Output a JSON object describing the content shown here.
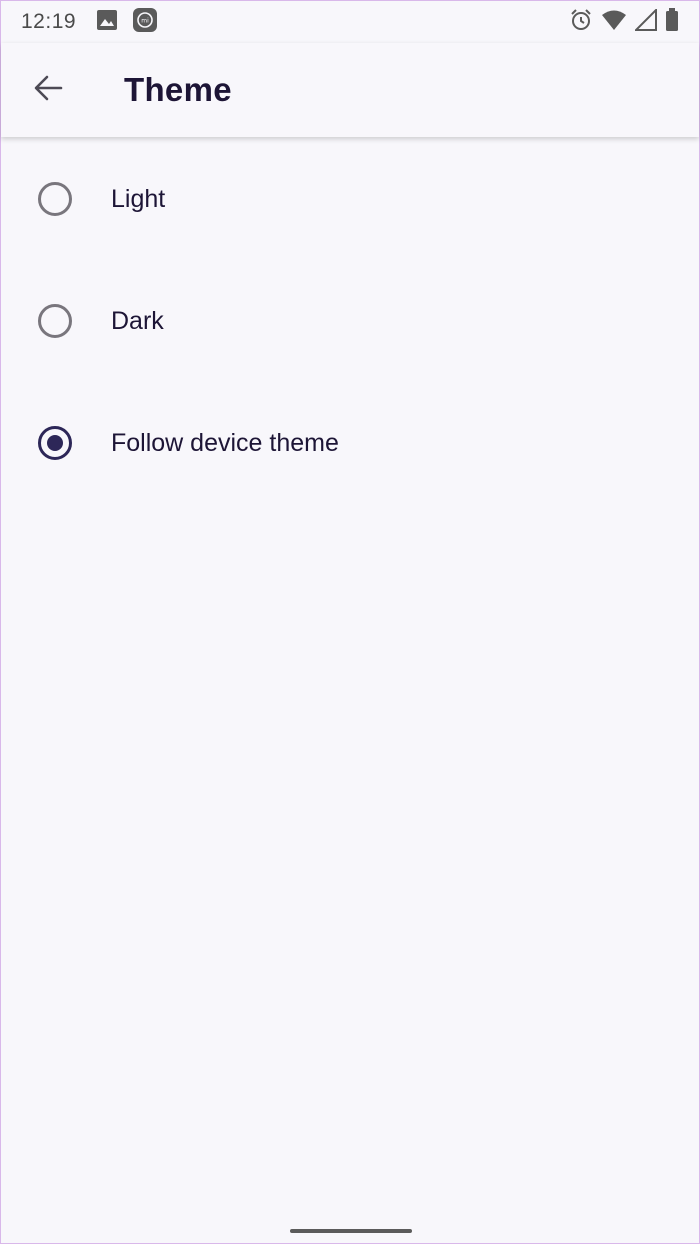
{
  "status_bar": {
    "time": "12:19",
    "left_icons": [
      "image-icon",
      "mi-app-icon"
    ],
    "right_icons": [
      "alarm-icon",
      "wifi-icon",
      "signal-icon",
      "battery-icon"
    ]
  },
  "app_bar": {
    "back_icon": "arrow-back-icon",
    "title": "Theme"
  },
  "theme_options": [
    {
      "label": "Light",
      "selected": false
    },
    {
      "label": "Dark",
      "selected": false
    },
    {
      "label": "Follow device theme",
      "selected": true
    }
  ],
  "colors": {
    "background": "#f8f7fb",
    "accent": "#2d2758",
    "text": "#1d1536",
    "radio_unselected": "#79767d"
  }
}
